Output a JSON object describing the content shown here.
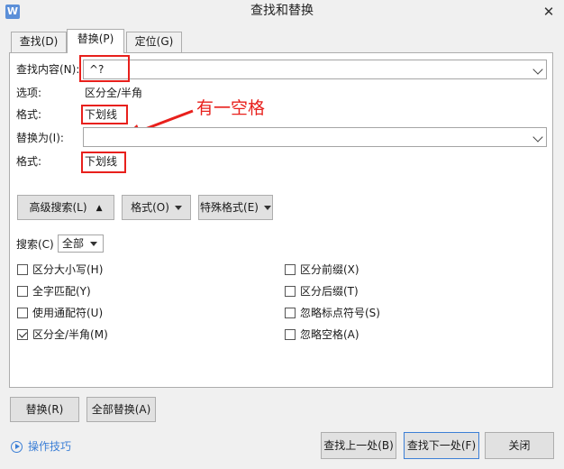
{
  "window": {
    "title": "查找和替换",
    "app_icon_letter": "W"
  },
  "tabs": [
    {
      "label": "查找(D)"
    },
    {
      "label": "替换(P)"
    },
    {
      "label": "定位(G)"
    }
  ],
  "find": {
    "label": "查找内容(N):",
    "value": "^?"
  },
  "options": {
    "label": "选项:",
    "value": "区分全/半角"
  },
  "find_format": {
    "label": "格式:",
    "value": "下划线"
  },
  "replace": {
    "label": "替换为(I):",
    "value": ""
  },
  "replace_format": {
    "label": "格式:",
    "value": "下划线"
  },
  "annotation": {
    "text": "有一空格",
    "color": "#e8201c"
  },
  "buttons": {
    "advanced": "高级搜索(L)",
    "format": "格式(O)",
    "special": "特殊格式(E)",
    "replace": "替换(R)",
    "replace_all": "全部替换(A)",
    "find_prev": "查找上一处(B)",
    "find_next": "查找下一处(F)",
    "close": "关闭"
  },
  "search_scope": {
    "label": "搜索(C)",
    "value": "全部"
  },
  "checkboxes_left": [
    {
      "label": "区分大小写(H)",
      "checked": false
    },
    {
      "label": "全字匹配(Y)",
      "checked": false
    },
    {
      "label": "使用通配符(U)",
      "checked": false
    },
    {
      "label": "区分全/半角(M)",
      "checked": true
    }
  ],
  "checkboxes_right": [
    {
      "label": "区分前缀(X)",
      "checked": false
    },
    {
      "label": "区分后缀(T)",
      "checked": false
    },
    {
      "label": "忽略标点符号(S)",
      "checked": false
    },
    {
      "label": "忽略空格(A)",
      "checked": false
    }
  ],
  "tips_link": "操作技巧"
}
